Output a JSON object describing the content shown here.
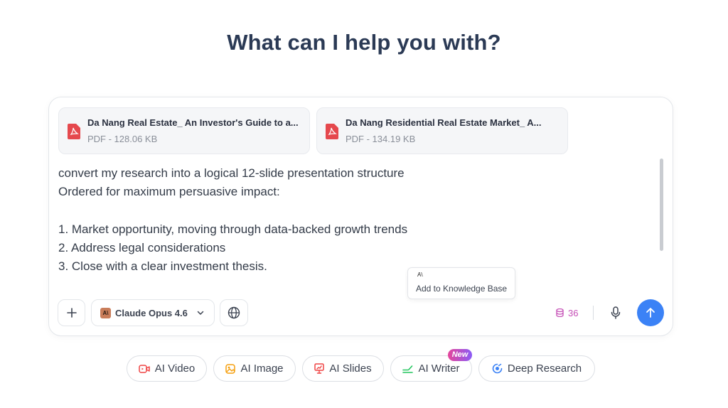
{
  "headline": "What can I help you with?",
  "attachments": [
    {
      "name": "Da Nang Real Estate_ An Investor's Guide to a...",
      "meta": "PDF - 128.06 KB",
      "icon": "pdf-icon"
    },
    {
      "name": "Da Nang Residential Real Estate Market_ A...",
      "meta": "PDF - 134.19 KB",
      "icon": "pdf-icon"
    }
  ],
  "prompt": {
    "text": "convert my research into a logical 12-slide presentation structure\nOrdered for maximum persuasive impact:\n\n1. Market opportunity, moving through data-backed growth trends\n2. Address legal considerations\n3. Close with a clear investment thesis."
  },
  "tooltip": {
    "glyph": "A\\",
    "text": "Add to Knowledge Base"
  },
  "toolbar": {
    "model_name": "Claude Opus 4.6",
    "model_logo": "A\\",
    "credits": "36",
    "icons": {
      "add": "plus-icon",
      "model_chevron": "chevron-down-icon",
      "web": "globe-icon",
      "credits": "coin-stack-icon",
      "voice": "microphone-icon",
      "send": "arrow-up-icon"
    }
  },
  "chips": [
    {
      "label": "AI Video",
      "icon": "video-icon",
      "color": "#ef4444"
    },
    {
      "label": "AI Image",
      "icon": "image-icon",
      "color": "#f59e0b"
    },
    {
      "label": "AI Slides",
      "icon": "slides-icon",
      "color": "#ef4444"
    },
    {
      "label": "AI Writer",
      "icon": "writer-icon",
      "color": "#22c55e",
      "badge": "New"
    },
    {
      "label": "Deep Research",
      "icon": "research-icon",
      "color": "#3b82f6"
    }
  ],
  "colors": {
    "accent": "#3b82f6",
    "headline": "#2b3a55",
    "pdf": "#e5484d",
    "credits": "#c54fb6"
  }
}
